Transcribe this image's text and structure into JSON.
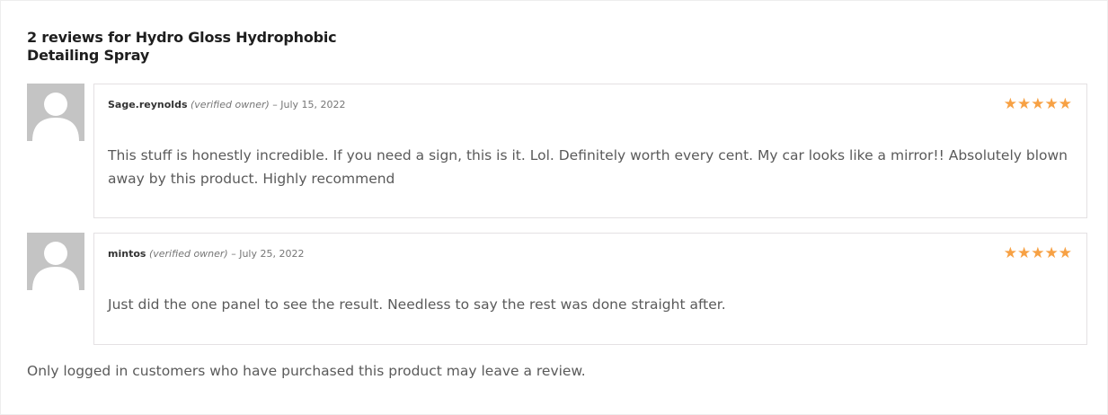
{
  "reviews_title": "2 reviews for Hydro Gloss Hydrophobic Detailing Spray",
  "colors": {
    "star": "#f7a144",
    "avatar_bg": "#c4c4c4",
    "border": "#e4e1e3"
  },
  "reviews": [
    {
      "author": "Sage.reynolds",
      "verified": "(verified owner)",
      "separator": "–",
      "date": "July 15, 2022",
      "rating": 5,
      "stars": "★★★★★",
      "text": "This stuff is honestly incredible. If you need a sign, this is it. Lol. Definitely worth every cent. My car looks like a mirror!! Absolutely blown away by this product. Highly recommend"
    },
    {
      "author": "mintos",
      "verified": "(verified owner)",
      "separator": "–",
      "date": "July 25, 2022",
      "rating": 5,
      "stars": "★★★★★",
      "text": "Just did the one panel to see the result. Needless to say the rest was done straight after."
    }
  ],
  "notice": "Only logged in customers who have purchased this product may leave a review.",
  "icons": {
    "avatar": "user-avatar-placeholder-icon",
    "star": "star-icon"
  }
}
